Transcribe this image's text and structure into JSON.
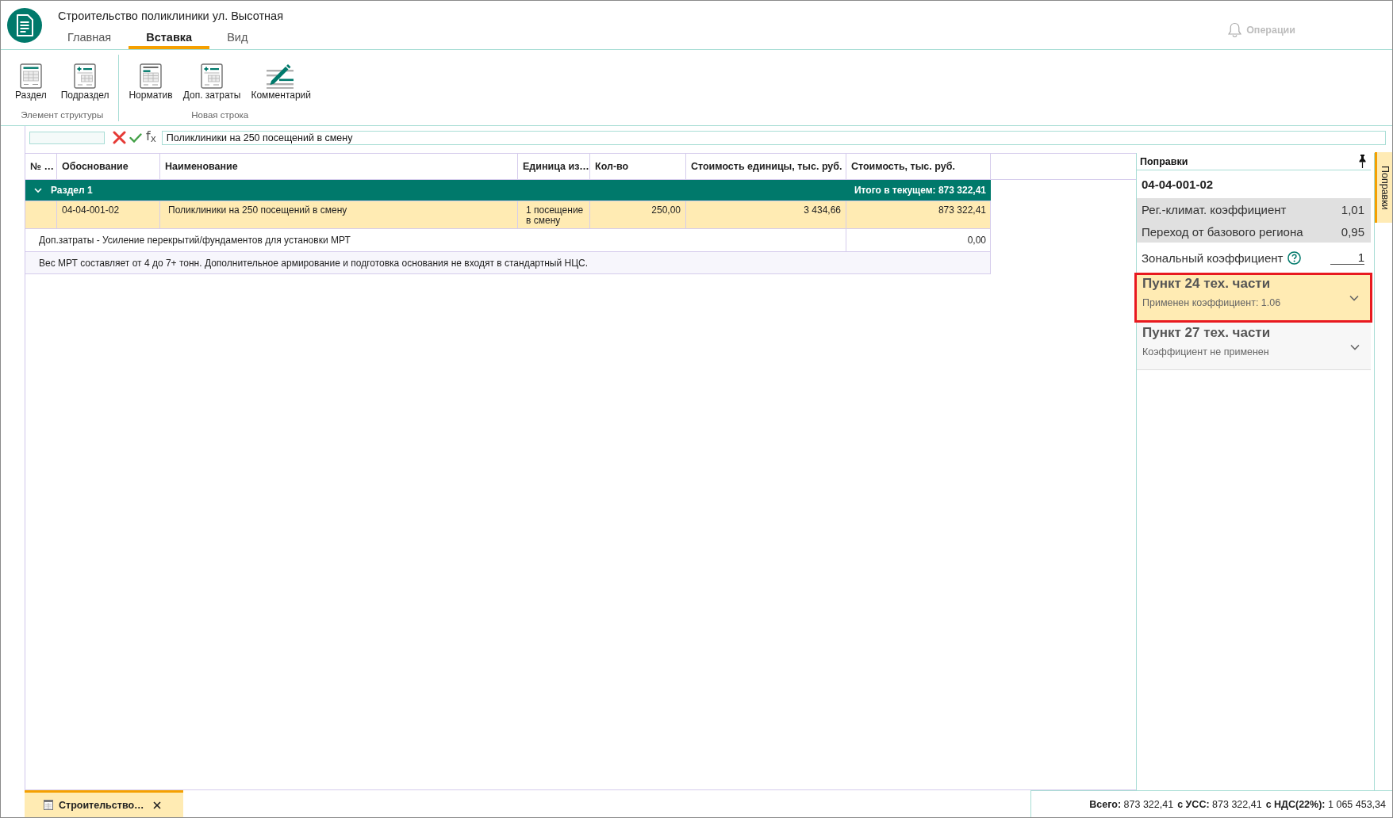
{
  "app": {
    "title": "Строительство поликлиники ул. Высотная"
  },
  "tabs": [
    {
      "label": "Главная",
      "selected": false
    },
    {
      "label": "Вставка",
      "selected": true
    },
    {
      "label": "Вид",
      "selected": false
    }
  ],
  "operations": {
    "label": "Операции",
    "disabled": true
  },
  "ribbon": {
    "groups": [
      {
        "label": "Элемент структуры",
        "buttons": [
          {
            "label": "Раздел",
            "kind": "section"
          },
          {
            "label": "Подраздел",
            "kind": "subsection"
          }
        ]
      },
      {
        "label": "Новая строка",
        "buttons": [
          {
            "label": "Норматив",
            "kind": "norm"
          },
          {
            "label": "Доп. затраты",
            "kind": "extra"
          },
          {
            "label": "Комментарий",
            "kind": "comment"
          }
        ]
      }
    ]
  },
  "formula_bar": {
    "function_label": "f$_{x}$",
    "value": "Поликлиники на 250 посещений в смену"
  },
  "table": {
    "columns": [
      "№ …",
      "Обоснование",
      "Наименование",
      "Единица из…",
      "Кол-во",
      "Стоимость единицы, тыс. руб.",
      "Стоимость, тыс. руб."
    ],
    "rows": [
      {
        "kind": "section",
        "selected": false,
        "expanded": true,
        "label": "Раздел 1",
        "total": "Итого в текущем: 873 322,41"
      },
      {
        "kind": "item",
        "selected": true,
        "code": "04-04-001-02",
        "name": "Поликлиники на 250 посещений в смену",
        "unit": "1 посещение в смену",
        "quantity": "250,00",
        "unit_cost": "3 434,66",
        "cost": "873 322,41"
      },
      {
        "kind": "extra",
        "selected": false,
        "text": "Доп.затраты - Усиление перекрытий/фундаментов для установки МРТ",
        "cost": "0,00"
      },
      {
        "kind": "comment",
        "selected": false,
        "text": "Вес МРТ составляет от 4 до 7+ тонн. Дополнительное армирование и подготовка основания не входят в стандартный НЦС."
      }
    ]
  },
  "corrections": {
    "title": "Поправки",
    "code": "04-04-001-02",
    "coefficients": [
      {
        "kind": "readonly",
        "label": "Рег.-климат. коэффициент",
        "value": "1,01"
      },
      {
        "kind": "readonly",
        "label": "Переход от базового региона",
        "value": "0,95"
      },
      {
        "kind": "input",
        "label": "Зональный коэффициент",
        "value": "1"
      }
    ],
    "clauses": [
      {
        "title": "Пункт 24 тех. части",
        "status": "Применен коэффициент: 1.06",
        "applied": true,
        "highlighted": true,
        "expanded": false
      },
      {
        "title": "Пункт 27 тех. части",
        "status": "Коэффициент не применен",
        "applied": false,
        "highlighted": false,
        "expanded": false
      }
    ]
  },
  "side_tab": {
    "label": "Поправки"
  },
  "document_tabs": [
    {
      "label": "Строительство…",
      "selected": true
    }
  ],
  "status_bar": [
    {
      "label": "Всего:",
      "value": "873 322,41"
    },
    {
      "label": "с УСС:",
      "value": "873 322,41"
    },
    {
      "label": "с НДС(22%):",
      "value": "1 065 453,34"
    }
  ]
}
